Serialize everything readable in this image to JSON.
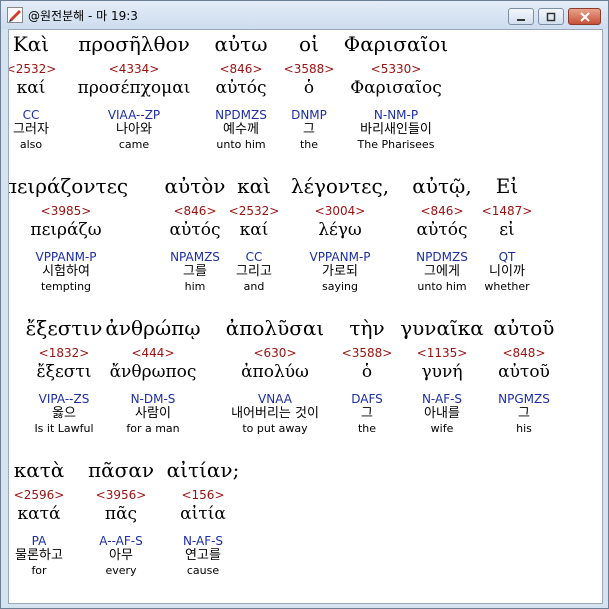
{
  "window": {
    "title": "@원전분해 - 마 19:3",
    "buttons": [
      "minimize",
      "maximize",
      "close"
    ]
  },
  "rows": [
    {
      "words": [
        {
          "greek": "Καὶ",
          "strong": "<2532>",
          "lemma": "καί",
          "parse": "CC",
          "korean": "그러자",
          "english": "also"
        },
        {
          "greek": "προσῆλθον",
          "strong": "<4334>",
          "lemma": "προσέπχομαι",
          "parse": "VIAA--ZP",
          "korean": "나아와",
          "english": "came"
        },
        {
          "greek": "αὐτω",
          "strong": "<846>",
          "lemma": "αὐτός",
          "parse": "NPDMZS",
          "korean": "예수께",
          "english": "unto him"
        },
        {
          "greek": "οἱ",
          "strong": "<3588>",
          "lemma": "ὁ",
          "parse": "DNMP",
          "korean": "그",
          "english": "the"
        },
        {
          "greek": "Φαρισαῖοι",
          "strong": "<5330>",
          "lemma": "Φαρισαῖος",
          "parse": "N-NM-P",
          "korean": "바리새인들이",
          "english": "The Pharisees"
        }
      ]
    },
    {
      "words": [
        {
          "greek": "πειράζοντες",
          "strong": "<3985>",
          "lemma": "πειράζω",
          "parse": "VPPANM-P",
          "korean": "시험하여",
          "english": "tempting"
        },
        {
          "greek": "αὐτὸν",
          "strong": "<846>",
          "lemma": "αὐτός",
          "parse": "NPAMZS",
          "korean": "그를",
          "english": "him"
        },
        {
          "greek": "καὶ",
          "strong": "<2532>",
          "lemma": "καί",
          "parse": "CC",
          "korean": "그리고",
          "english": "and"
        },
        {
          "greek": "λέγοντες,",
          "strong": "<3004>",
          "lemma": "λέγω",
          "parse": "VPPANM-P",
          "korean": "가로되",
          "english": "saying"
        },
        {
          "greek": "αὐτῷ,",
          "strong": "<846>",
          "lemma": "αὐτός",
          "parse": "NPDMZS",
          "korean": "그에게",
          "english": "unto him"
        },
        {
          "greek": "Εἰ",
          "strong": "<1487>",
          "lemma": "εἰ",
          "parse": "QT",
          "korean": "니이까",
          "english": "whether"
        }
      ]
    },
    {
      "words": [
        {
          "greek": "ἔξεστιν",
          "strong": "<1832>",
          "lemma": "ἔξεστι",
          "parse": "VIPA--ZS",
          "korean": "옳으",
          "english": "Is it Lawful"
        },
        {
          "greek": "ἀνθρώπῳ",
          "strong": "<444>",
          "lemma": "ἄνθρωπος",
          "parse": "N-DM-S",
          "korean": "사람이",
          "english": "for a man"
        },
        {
          "greek": "ἀπολῦσαι",
          "strong": "<630>",
          "lemma": "ἀπολύω",
          "parse": "VNAA",
          "korean": "내어버리는 것이",
          "english": "to put away"
        },
        {
          "greek": "τὴν",
          "strong": "<3588>",
          "lemma": "ὁ",
          "parse": "DAFS",
          "korean": "그",
          "english": "the"
        },
        {
          "greek": "γυναῖκα",
          "strong": "<1135>",
          "lemma": "γυνή",
          "parse": "N-AF-S",
          "korean": "아내를",
          "english": "wife"
        },
        {
          "greek": "αὐτοῦ",
          "strong": "<848>",
          "lemma": "αὐτοῦ",
          "parse": "NPGMZS",
          "korean": "그",
          "english": "his"
        }
      ]
    },
    {
      "words": [
        {
          "greek": "κατὰ",
          "strong": "<2596>",
          "lemma": "κατά",
          "parse": "PA",
          "korean": "물론하고",
          "english": "for"
        },
        {
          "greek": "πᾶσαν",
          "strong": "<3956>",
          "lemma": "πᾶς",
          "parse": "A--AF-S",
          "korean": "아무",
          "english": "every"
        },
        {
          "greek": "αἰτίαν;",
          "strong": "<156>",
          "lemma": "αἰτία",
          "parse": "N-AF-S",
          "korean": "연고를",
          "english": "cause"
        }
      ]
    }
  ]
}
